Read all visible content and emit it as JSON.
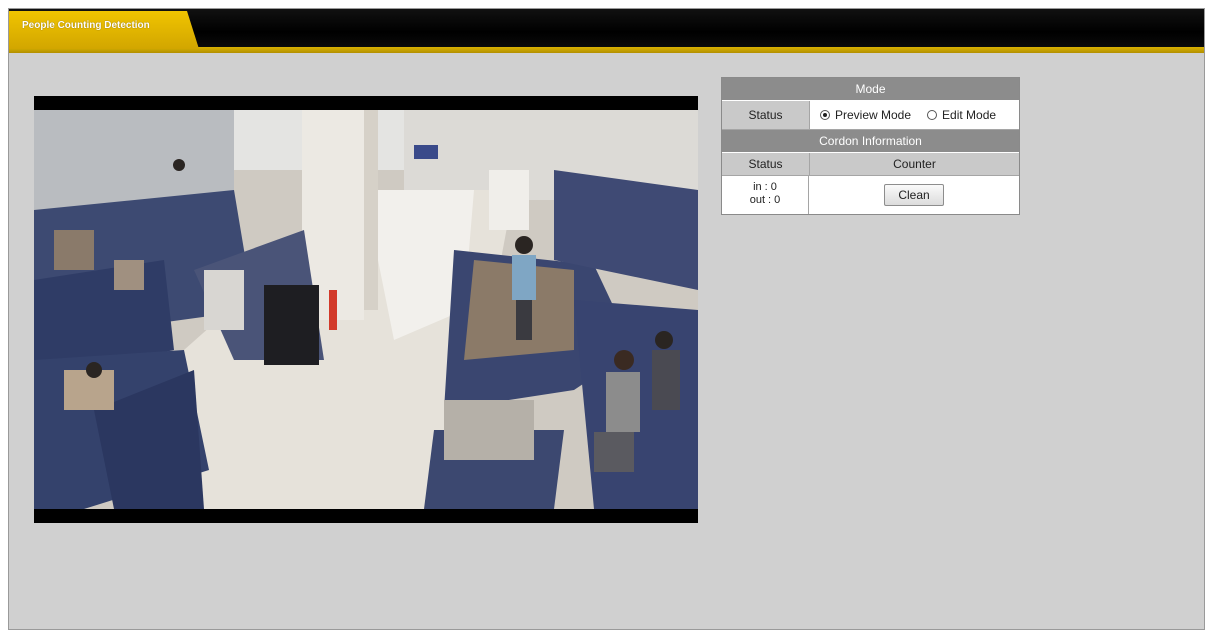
{
  "tab": {
    "label": "People Counting Detection"
  },
  "panel": {
    "mode_header": "Mode",
    "status_label": "Status",
    "mode_options": [
      {
        "label": "Preview Mode",
        "selected": true
      },
      {
        "label": "Edit Mode",
        "selected": false
      }
    ],
    "cordon_header": "Cordon Information",
    "col_status": "Status",
    "col_counter": "Counter",
    "in_text": "in : 0",
    "out_text": "out : 0",
    "clean_label": "Clean"
  },
  "colors": {
    "accent": "#e0b800",
    "header": "#8c8c8c",
    "background": "#d0d0d0"
  }
}
